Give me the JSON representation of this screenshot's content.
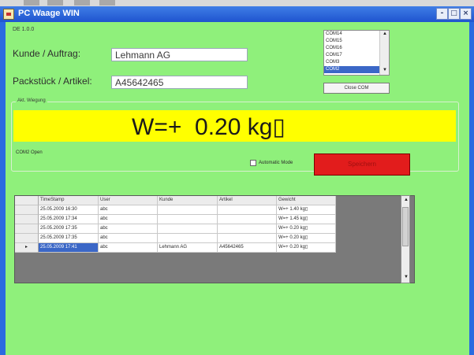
{
  "window": {
    "title": "PC Waage WIN",
    "controls": {
      "minimize": "-",
      "maximize": "□",
      "close": "×"
    }
  },
  "version": "DE 1.0.0",
  "form": {
    "customer_label": "Kunde / Auftrag:",
    "customer_value": "Lehmann AG",
    "package_label": "Packstück / Artikel:",
    "package_value": "A45642465"
  },
  "com_ports": {
    "items": [
      "COM14",
      "COM15",
      "COM16",
      "COM17",
      "COM3",
      "COM2"
    ],
    "selected": "COM2",
    "close_button": "Close COM"
  },
  "weighing": {
    "group_label": "Akt. Wiegung",
    "display": "W=+  0.20 kg▯"
  },
  "status": "COM2 Open",
  "automatic_mode_label": "Automatic Mode",
  "save_button": "Speichern",
  "table": {
    "columns": [
      "TimeStamp",
      "User",
      "Kunde",
      "Artikel",
      "Gewicht"
    ],
    "rows": [
      [
        "25.05.2009 16:30",
        "abc",
        "",
        "",
        "W=+  1.40 kg▯"
      ],
      [
        "25.05.2009 17:34",
        "abc",
        "",
        "",
        "W=+  1.45 kg▯"
      ],
      [
        "25.05.2009 17:35",
        "abc",
        "",
        "",
        "W=+  0.20 kg▯"
      ],
      [
        "25.05.2009 17:35",
        "abc",
        "",
        "",
        "W=+  0.20 kg▯"
      ],
      [
        "25.05.2009 17:41",
        "abc",
        "Lehmann AG",
        "A45642465",
        "W=+  0.20 kg▯"
      ]
    ],
    "current_row_marker": "▸",
    "selected_row": 4
  },
  "colors": {
    "client_bg": "#8ff07b",
    "display_bg": "#ffff00",
    "save_button": "#e21c1c",
    "title_bar": "#2a6be0"
  }
}
